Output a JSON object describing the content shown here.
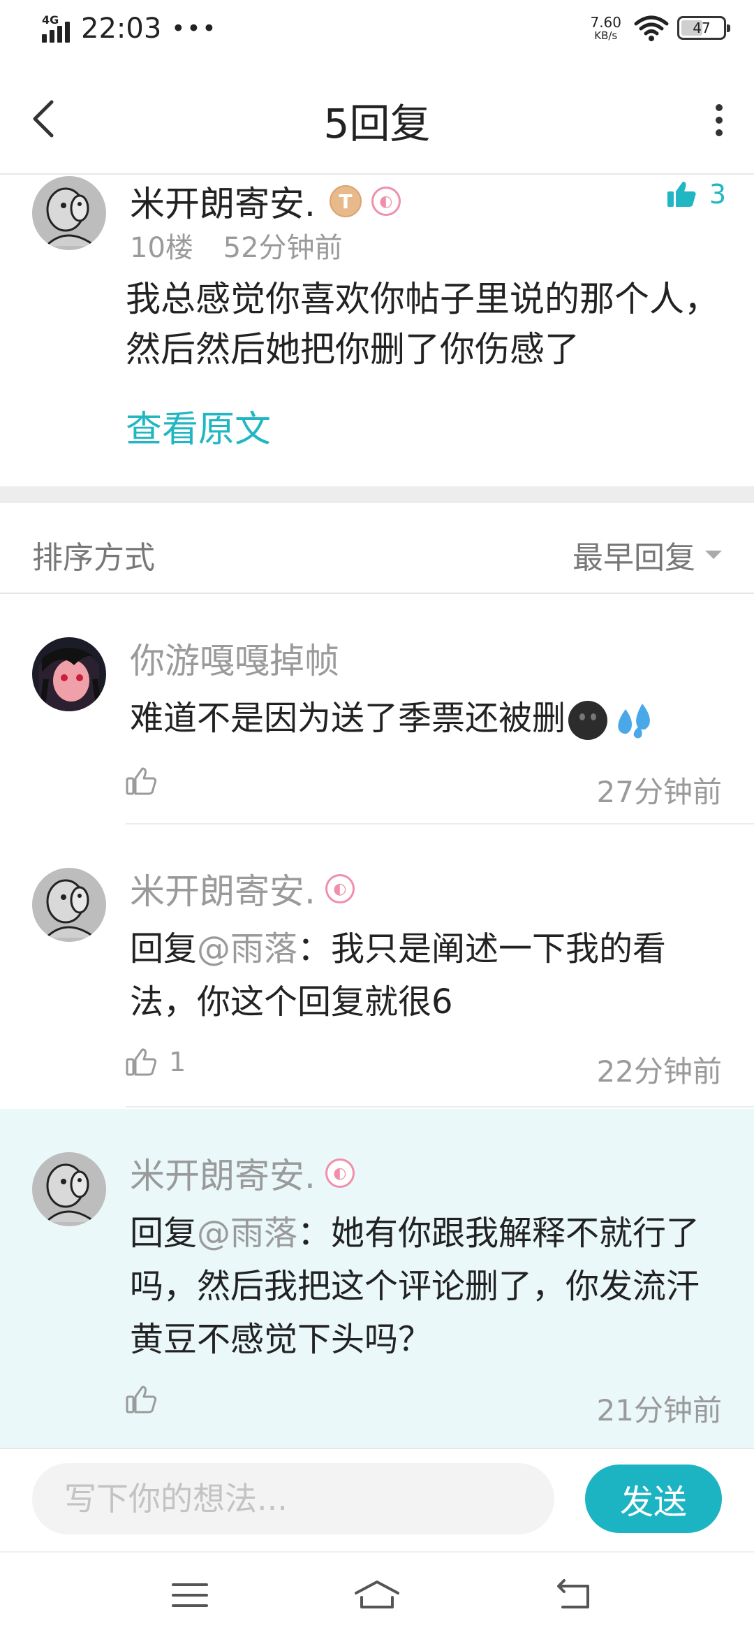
{
  "status_bar": {
    "network": "4G",
    "time": "22:03",
    "dots": "•••",
    "speed_value": "7.60",
    "speed_unit": "KB/s",
    "battery": "47"
  },
  "header": {
    "title": "5回复"
  },
  "main_comment": {
    "author": "米开朗寄安.",
    "medal_text": "T",
    "likes": "3",
    "floor": "10楼",
    "time": "52分钟前",
    "content": "我总感觉你喜欢你帖子里说的那个人，然后然后她把你删了你伤感了",
    "view_original": "查看原文"
  },
  "sort": {
    "label": "排序方式",
    "selected": "最早回复"
  },
  "replies": [
    {
      "author": "你游嘎嘎掉帧",
      "text": "难道不是因为送了季票还被删",
      "likes": "",
      "time": "27分钟前"
    },
    {
      "author": "米开朗寄安.",
      "prefix": "回复",
      "mention": "@雨落",
      "text": "：我只是阐述一下我的看法，你这个回复就很6",
      "likes": "1",
      "time": "22分钟前"
    },
    {
      "author": "米开朗寄安.",
      "prefix": "回复",
      "mention": "@雨落",
      "text": "：她有你跟我解释不就行了吗，然后我把这个评论删了，你发流汗黄豆不感觉下头吗？",
      "likes": "",
      "time": "21分钟前"
    }
  ],
  "composer": {
    "placeholder": "写下你的想法...",
    "send_label": "发送"
  },
  "colors": {
    "accent": "#1cb4c3",
    "highlight_bg": "#eaf8fa",
    "muted_text": "#9a9a9a"
  },
  "icons": [
    "back-icon",
    "more-icon",
    "thumb-up-icon",
    "menu-icon",
    "home-icon",
    "return-icon",
    "wifi-icon",
    "battery-icon"
  ]
}
